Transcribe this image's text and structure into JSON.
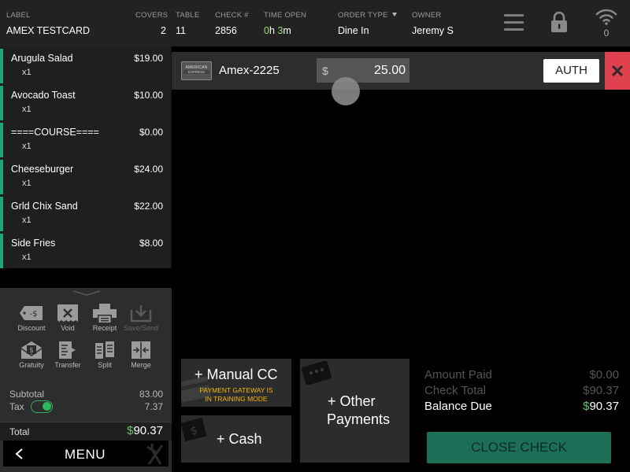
{
  "header": {
    "label": {
      "title": "LABEL",
      "value": "AMEX TESTCARD"
    },
    "covers": {
      "title": "COVERS",
      "value": "2"
    },
    "table": {
      "title": "TABLE",
      "value": "11"
    },
    "check": {
      "title": "CHECK #",
      "value": "2856"
    },
    "time_open": {
      "title": "TIME OPEN",
      "hours": "0",
      "h_unit": "h",
      "minutes": "3",
      "m_unit": "m"
    },
    "order_type": {
      "title": "ORDER TYPE",
      "value": "Dine In"
    },
    "owner": {
      "title": "OWNER",
      "value": "Jeremy S"
    },
    "wifi_count": "0"
  },
  "order_items": [
    {
      "name": "Arugula Salad",
      "qty": "x1",
      "price": "$19.00"
    },
    {
      "name": "Avocado Toast",
      "qty": "x1",
      "price": "$10.00"
    },
    {
      "name": "====COURSE====",
      "qty": "x1",
      "price": "$0.00"
    },
    {
      "name": "Cheeseburger",
      "qty": "x1",
      "price": "$24.00"
    },
    {
      "name": "Grld Chix Sand",
      "qty": "x1",
      "price": "$22.00"
    },
    {
      "name": "Side Fries",
      "qty": "x1",
      "price": "$8.00"
    }
  ],
  "actions": {
    "discount": "Discount",
    "void": "Void",
    "receipt": "Receipt",
    "save_send": "Save/Send",
    "gratuity": "Gratuity",
    "transfer": "Transfer",
    "split": "Split",
    "merge": "Merge"
  },
  "totals": {
    "subtotal_label": "Subtotal",
    "subtotal_value": "83.00",
    "tax_label": "Tax",
    "tax_value": "7.37",
    "tax_enabled": true,
    "total_label": "Total",
    "total_currency": "$",
    "total_amount": "90.37"
  },
  "menu_label": "MENU",
  "payment": {
    "card_brand_line1": "AMERICAN",
    "card_brand_line2": "EXPRESS",
    "name": "Amex-2225",
    "currency": "$",
    "amount": "25.00",
    "auth_label": "AUTH"
  },
  "buttons": {
    "manual_cc": "+ Manual CC",
    "gateway_warning_line1": "PAYMENT GATEWAY IS",
    "gateway_warning_line2": "IN TRAINING MODE",
    "cash": "+ Cash",
    "other_line1": "+ Other",
    "other_line2": "Payments",
    "close_check": "CLOSE CHECK"
  },
  "summary": {
    "amount_paid_label": "Amount Paid",
    "amount_paid_value": "$0.00",
    "check_total_label": "Check Total",
    "check_total_value": "$90.37",
    "balance_due_label": "Balance Due",
    "balance_due_currency": "$",
    "balance_due_value": "90.37"
  },
  "colors": {
    "accent_green": "#1fa57a",
    "close_check_bg": "#1d6e56",
    "delete_red": "#e0414f",
    "warning_yellow": "#f5b800"
  }
}
